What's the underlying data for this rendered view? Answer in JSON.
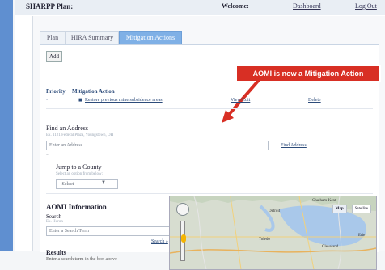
{
  "header": {
    "app": "SHARPP Plan:",
    "welcome": "Welcome:",
    "dashboard": "Dashboard",
    "logout": "Log Out"
  },
  "tabs": [
    {
      "label": "Plan"
    },
    {
      "label": "HIRA Summary"
    },
    {
      "label": "Mitigation Actions"
    }
  ],
  "toolbar": {
    "add": "Add"
  },
  "callout": {
    "text": "AOMI is now a Mitigation Action"
  },
  "table": {
    "priority": "Priority",
    "mitigation_action": "Mitigation Action",
    "row": {
      "priority": "•",
      "action": "Restore previous mine subsidence areas",
      "view_edit": "View/Edit",
      "delete": "Delete"
    }
  },
  "find_address": {
    "title": "Find an Address",
    "help": "Ex. 1121 Federal Plaza, Youngstown, OH",
    "placeholder": "Enter an Address",
    "link": "Find Address"
  },
  "jump_county": {
    "title": "Jump to a County",
    "help": "Select an option from below:",
    "select": "- Select -"
  },
  "aomi": {
    "title": "AOMI Information",
    "search_label": "Search",
    "search_help": "Ex. Huron",
    "search_placeholder": "Enter a Search Term",
    "search_link": "Search »",
    "results_title": "Results",
    "results_note": "Enter a search term in the box above"
  },
  "map": {
    "map": "Map",
    "satellite": "Satellite",
    "places": [
      "Chatham-Kent",
      "Detroit",
      "Toledo",
      "Cleveland",
      "Erie"
    ]
  }
}
